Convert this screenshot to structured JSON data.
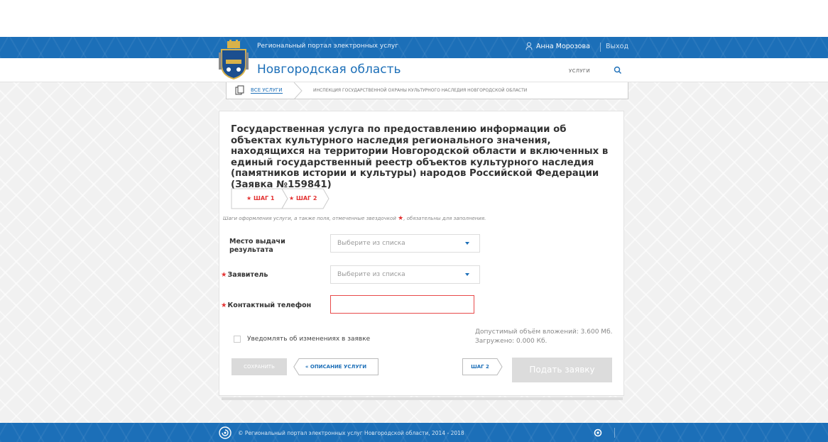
{
  "header": {
    "portal_name": "Региональный портал электронных услуг",
    "user_name": "Анна Морозова",
    "logout": "Выход",
    "region_title": "Новгородская область",
    "services_link": "услуги",
    "search_icon": "search-icon",
    "emblem": "novgorod-coat-of-arms"
  },
  "breadcrumb": {
    "all_services": "ВСЕ УСЛУГИ",
    "current": "ИНСПЕКЦИЯ ГОСУДАРСТВЕННОЙ ОХРАНЫ КУЛЬТУРНОГО НАСЛЕДИЯ НОВГОРОДСКОЙ ОБЛАСТИ"
  },
  "service": {
    "title": "Государственная услуга по предоставлению информации об объектах культурного наследия регионального значения, находящихся на территории Новгородской области и включенных в единый государственный реестр объектов культурного наследия (памятников истории и культуры) народов Российской Федерации (Заявка №159841)"
  },
  "steps": {
    "step1": "ШАГ 1",
    "step2": "ШАГ 2",
    "hint_before": "Шаги оформления услуги, а также поля, отмеченные звездочкой",
    "hint_after": ", обязательны для заполнения."
  },
  "form": {
    "place_label": "Место выдачи результата",
    "place_value": "Выберите из списка",
    "applicant_label": "Заявитель",
    "applicant_value": "Выберите из списка",
    "phone_label": "Контактный телефон",
    "phone_value": "",
    "notify_label": "Уведомлять об изменениях в заявке"
  },
  "attachments": {
    "allowed": "Допустимый объём вложений: 3.600 Мб.",
    "uploaded": "Загружено: 0.000 Кб."
  },
  "buttons": {
    "save": "СОХРАНИТЬ",
    "description": "« ОПИСАНИЕ УСЛУГИ",
    "step2": "ШАГ 2",
    "submit": "Подать заявку"
  },
  "footer": {
    "text": "© Региональный портал электронных услуг Новгородской области, 2014 - 2018"
  },
  "colors": {
    "brand_blue": "#1c6fb8",
    "required_red": "#e33333",
    "error_border": "#e84a4a"
  }
}
